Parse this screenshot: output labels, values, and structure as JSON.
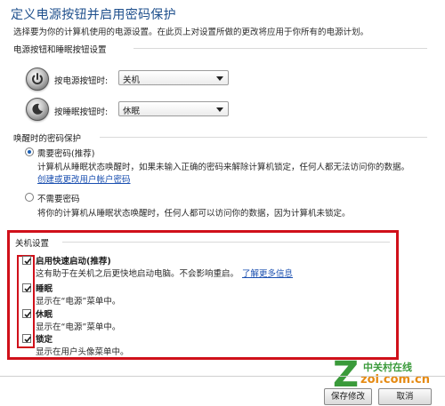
{
  "page": {
    "title": "定义电源按钮并启用密码保护",
    "description": "选择要为你的计算机使用的电源设置。在此页上对设置所做的更改将应用于你所有的电源计划。"
  },
  "power_buttons": {
    "header": "电源按钮和睡眠按钮设置",
    "power_label": "按电源按钮时:",
    "power_value": "关机",
    "sleep_label": "按睡眠按钮时:",
    "sleep_value": "休眠"
  },
  "wake_password": {
    "header": "唤醒时的密码保护",
    "require": {
      "label": "需要密码(推荐)",
      "desc": "计算机从睡眠状态唤醒时，如果未输入正确的密码来解除计算机锁定，任何人都无法访问你的数据。",
      "link": "创建或更改用户帐户密码",
      "selected": true
    },
    "no_require": {
      "label": "不需要密码",
      "desc": "将你的计算机从睡眠状态唤醒时，任何人都可以访问你的数据，因为计算机未锁定。",
      "selected": false
    }
  },
  "shutdown": {
    "header": "关机设置",
    "items": [
      {
        "label": "启用快速启动(推荐)",
        "desc": "这有助于在关机之后更快地启动电脑。不会影响重启。",
        "link": "了解更多信息",
        "checked": true
      },
      {
        "label": "睡眠",
        "desc": "显示在“电源”菜单中。",
        "checked": true
      },
      {
        "label": "休眠",
        "desc": "显示在“电源”菜单中。",
        "checked": true
      },
      {
        "label": "锁定",
        "desc": "显示在用户头像菜单中。",
        "checked": true
      }
    ]
  },
  "footer": {
    "save_label": "保存修改",
    "cancel_label": "取消"
  },
  "watermark": {
    "letter": "Z",
    "cn": "中关村在线",
    "url": "zol.com.cn"
  },
  "colors": {
    "title": "#1e4f8c",
    "link": "#1a4fb0",
    "highlight": "#d0101a",
    "watermark_green": "#3a9a3a",
    "watermark_orange": "#e58a12"
  },
  "icons": {
    "power": "power-icon",
    "sleep": "moon-icon",
    "check": "checkmark-icon"
  }
}
